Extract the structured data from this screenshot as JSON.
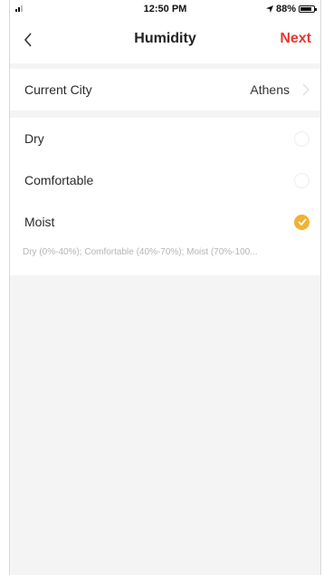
{
  "status_bar": {
    "time": "12:50 PM",
    "battery": "88%",
    "battery_level": 0.88,
    "icons": [
      "signal-icon",
      "location-arrow-icon",
      "battery-icon"
    ]
  },
  "nav": {
    "title": "Humidity",
    "next_label": "Next",
    "back_icon": "chevron-left-icon",
    "accent_color": "#e8392d"
  },
  "city": {
    "label": "Current City",
    "value": "Athens"
  },
  "options": [
    {
      "label": "Dry",
      "selected": false
    },
    {
      "label": "Comfortable",
      "selected": false
    },
    {
      "label": "Moist",
      "selected": true
    }
  ],
  "hint": "Dry (0%-40%); Comfortable (40%-70%); Moist (70%-100...",
  "selected_color": "#f3b233"
}
